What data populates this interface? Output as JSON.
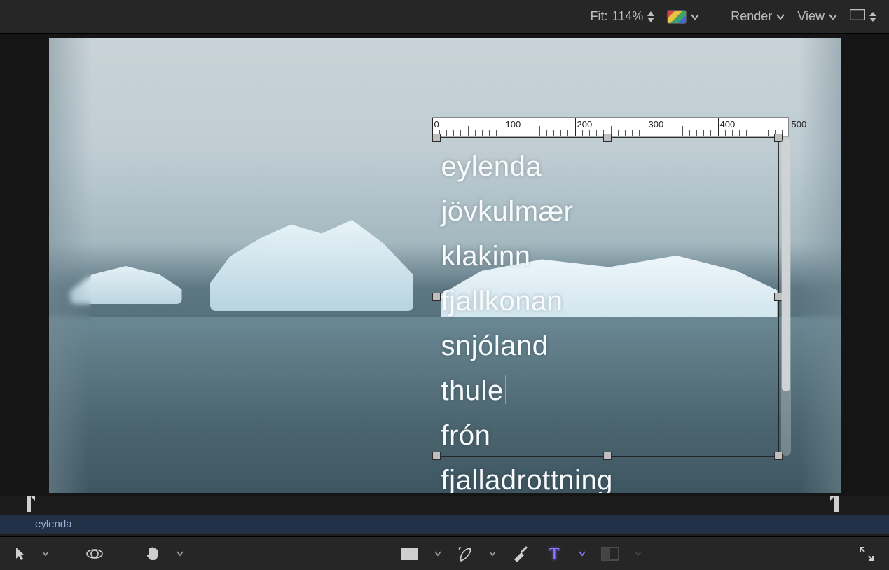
{
  "topbar": {
    "fit_label": "Fit:",
    "fit_value": "114%",
    "render_label": "Render",
    "view_label": "View"
  },
  "ruler": {
    "majors": [
      0,
      100,
      200,
      300,
      400,
      500
    ],
    "labels": [
      "0",
      "100",
      "200",
      "300",
      "400",
      "500"
    ]
  },
  "text_box": {
    "lines": [
      "eylenda",
      "jövkulmær",
      "klakinn",
      "fjallkonan",
      "snjóland",
      "thule",
      "frón",
      "fjalladrottning"
    ],
    "cursor_after_line_index": 5
  },
  "timeline": {
    "clip_label": "eylenda"
  },
  "tools": {
    "select": "select-tool",
    "orbit": "orbit-tool",
    "pan": "pan-tool",
    "rectangle": "rectangle-tool",
    "pen": "pen-tool",
    "brush": "brush-tool",
    "text": "text-tool",
    "mask": "mask-tool",
    "fullscreen": "fullscreen-toggle"
  }
}
